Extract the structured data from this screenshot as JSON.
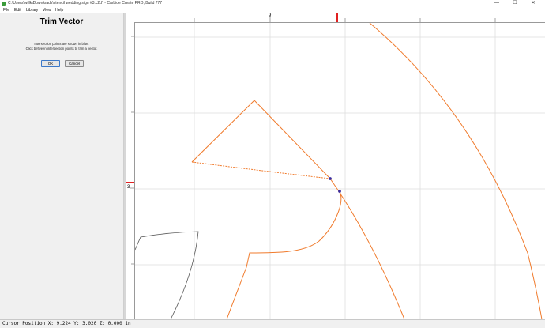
{
  "window": {
    "title": "C:\\Users\\willk\\Downloads\\stencil wedding sign #3.c2d* - Carbide Create PRO, Build 777",
    "controls": {
      "minimize": "—",
      "maximize": "☐",
      "close": "✕"
    }
  },
  "menu": [
    "File",
    "Edit",
    "Library",
    "View",
    "Help"
  ],
  "panel": {
    "title": "Trim Vector",
    "instructions": [
      "Intersection points are shown in blue.",
      "Click between intersection points to trim a vector."
    ],
    "ok_label": "OK",
    "cancel_label": "Cancel"
  },
  "rulers": {
    "top_label": "9",
    "left_label": "3"
  },
  "status": {
    "text": "Cursor Position X: 9.224 Y: 3.020 Z: 0.000 in"
  },
  "colors": {
    "vector": "#f07b2d",
    "intersection": "#3a2ea0",
    "other_vector": "#555555",
    "grid": "#dcdcdc",
    "ruler_marker": "#e02020"
  }
}
